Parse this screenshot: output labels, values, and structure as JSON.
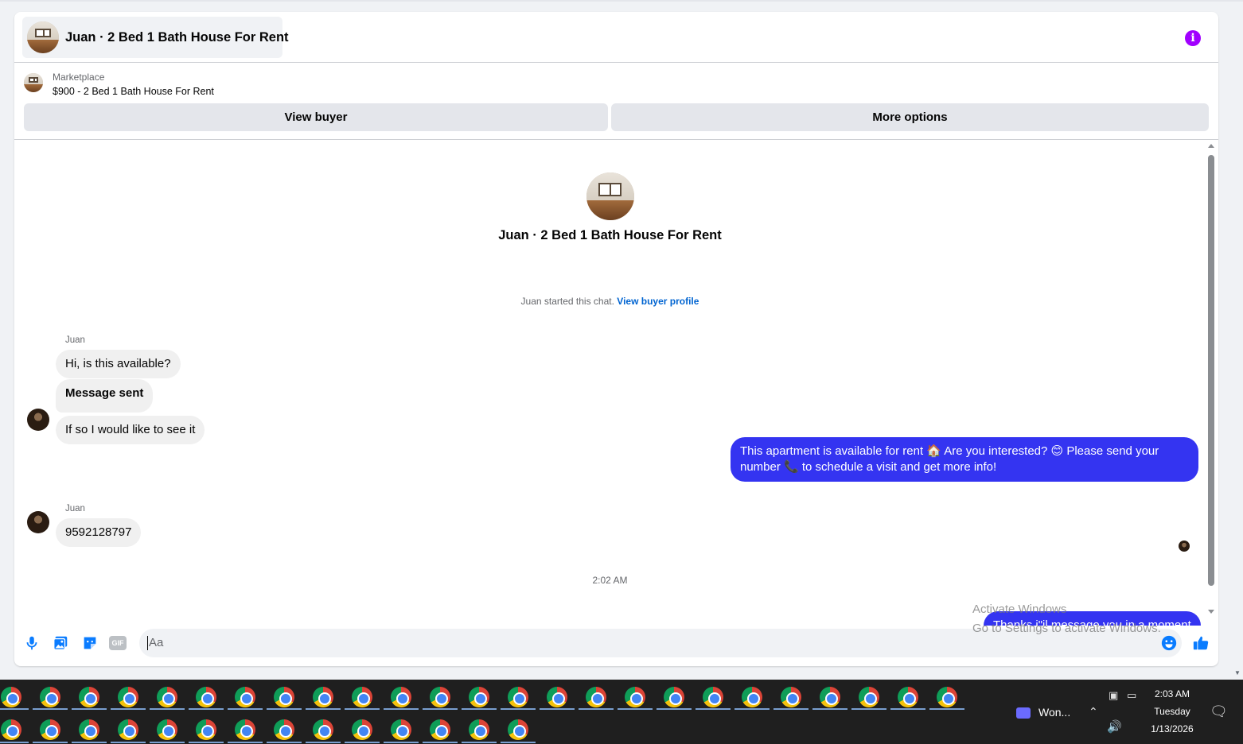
{
  "header": {
    "title": "Juan · 2 Bed 1 Bath House For Rent",
    "info_glyph": "i"
  },
  "listing": {
    "source": "Marketplace",
    "title": "$900 - 2 Bed 1 Bath House For Rent",
    "view_buyer_label": "View buyer",
    "more_options_label": "More options"
  },
  "chat": {
    "intro_name": "Juan · 2 Bed 1 Bath House For Rent",
    "started_text": "Juan started this chat.",
    "started_link": "View buyer profile",
    "sender_name_1": "Juan",
    "msg_1": "Hi, is this available?",
    "msg_2": "Message sent",
    "msg_3": "If so I would like to see it",
    "my_msg_1": "This apartment is available for rent 🏠 Are you interested? 😊 Please send your number 📞 to schedule a visit and get more info!",
    "sender_name_2": "Juan",
    "msg_4": "9592128797",
    "timestamp": "2:02 AM",
    "my_msg_2": "Thanks i\"il message you in a moment"
  },
  "composer": {
    "placeholder": "Aa",
    "icons": [
      "microphone-icon",
      "photo-icon",
      "sticker-icon",
      "gif-icon",
      "emoji-icon",
      "thumbs-up-icon"
    ],
    "gif_label": "GIF"
  },
  "watermark": {
    "line1": "Activate Windows",
    "line2": "Go to Settings to activate Windows."
  },
  "taskbar": {
    "app_label": "Won...",
    "time": "2:03 AM",
    "day": "Tuesday",
    "date": "1/13/2026"
  },
  "colors": {
    "accent": "#3434f1",
    "link": "#0064d1",
    "info": "#a100ff",
    "composer_icons": "#0a7cff"
  }
}
